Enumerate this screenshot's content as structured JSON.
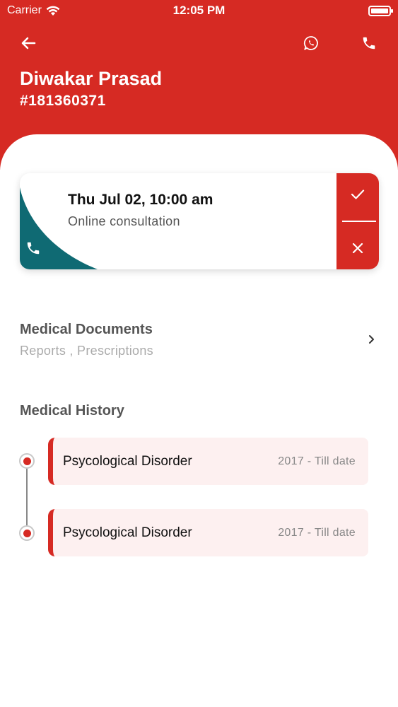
{
  "status_bar": {
    "carrier": "Carrier",
    "time": "12:05 PM"
  },
  "header": {
    "patient_name": "Diwakar Prasad",
    "patient_id": "#181360371"
  },
  "appointment": {
    "datetime": "Thu Jul 02, 10:00 am",
    "type": "Online consultation"
  },
  "medical_documents": {
    "title": "Medical Documents",
    "subtitle": "Reports , Prescriptions"
  },
  "medical_history": {
    "title": "Medical History",
    "items": [
      {
        "name": "Psycological Disorder",
        "dates": "2017 - Till date"
      },
      {
        "name": "Psycological Disorder",
        "dates": "2017 - Till date"
      }
    ]
  },
  "colors": {
    "brand": "#d62a23",
    "teal": "#0f6a73",
    "card_bg": "#fdf0f0"
  },
  "icons": [
    "back-arrow-icon",
    "whatsapp-icon",
    "phone-icon",
    "check-icon",
    "close-icon",
    "chevron-right-icon",
    "wifi-icon"
  ]
}
